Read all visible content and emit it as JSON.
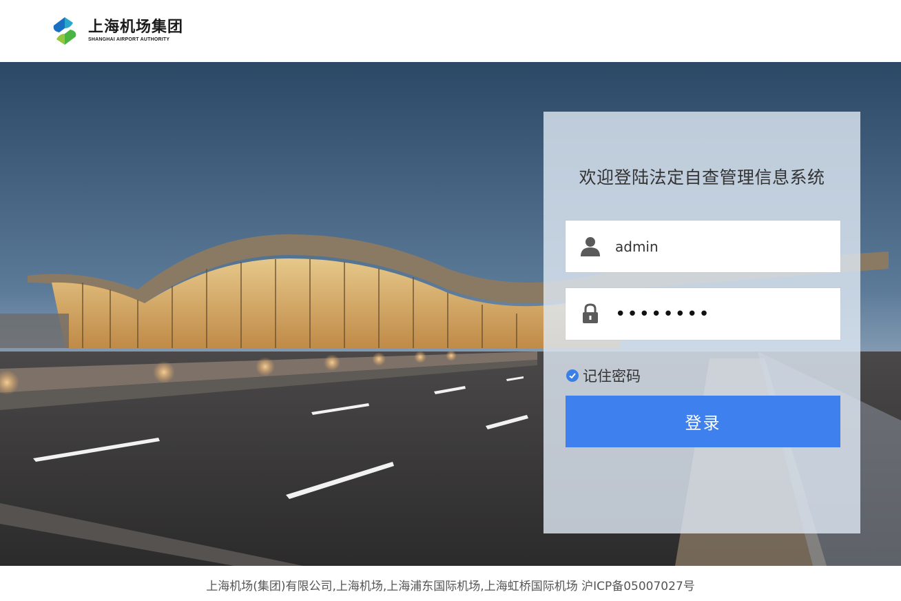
{
  "header": {
    "logo_cn": "上海机场集团",
    "logo_en": "SHANGHAI AIRPORT AUTHORITY"
  },
  "login": {
    "title": "欢迎登陆法定自查管理信息系统",
    "username_value": "admin",
    "password_mask": "••••••••",
    "remember_label": "记住密码",
    "remember_checked": true,
    "submit_label": "登录"
  },
  "footer": {
    "text": "上海机场(集团)有限公司,上海机场,上海浦东国际机场,上海虹桥国际机场 沪ICP备05007027号"
  },
  "colors": {
    "accent": "#3e80ee",
    "panel_bg": "#dde6f2",
    "sky_top": "#2e4a66",
    "road": "#3a3a3a"
  },
  "icons": {
    "logo": "airport-logo-icon",
    "user": "user-icon",
    "lock": "lock-icon",
    "check": "check-circle-icon"
  }
}
